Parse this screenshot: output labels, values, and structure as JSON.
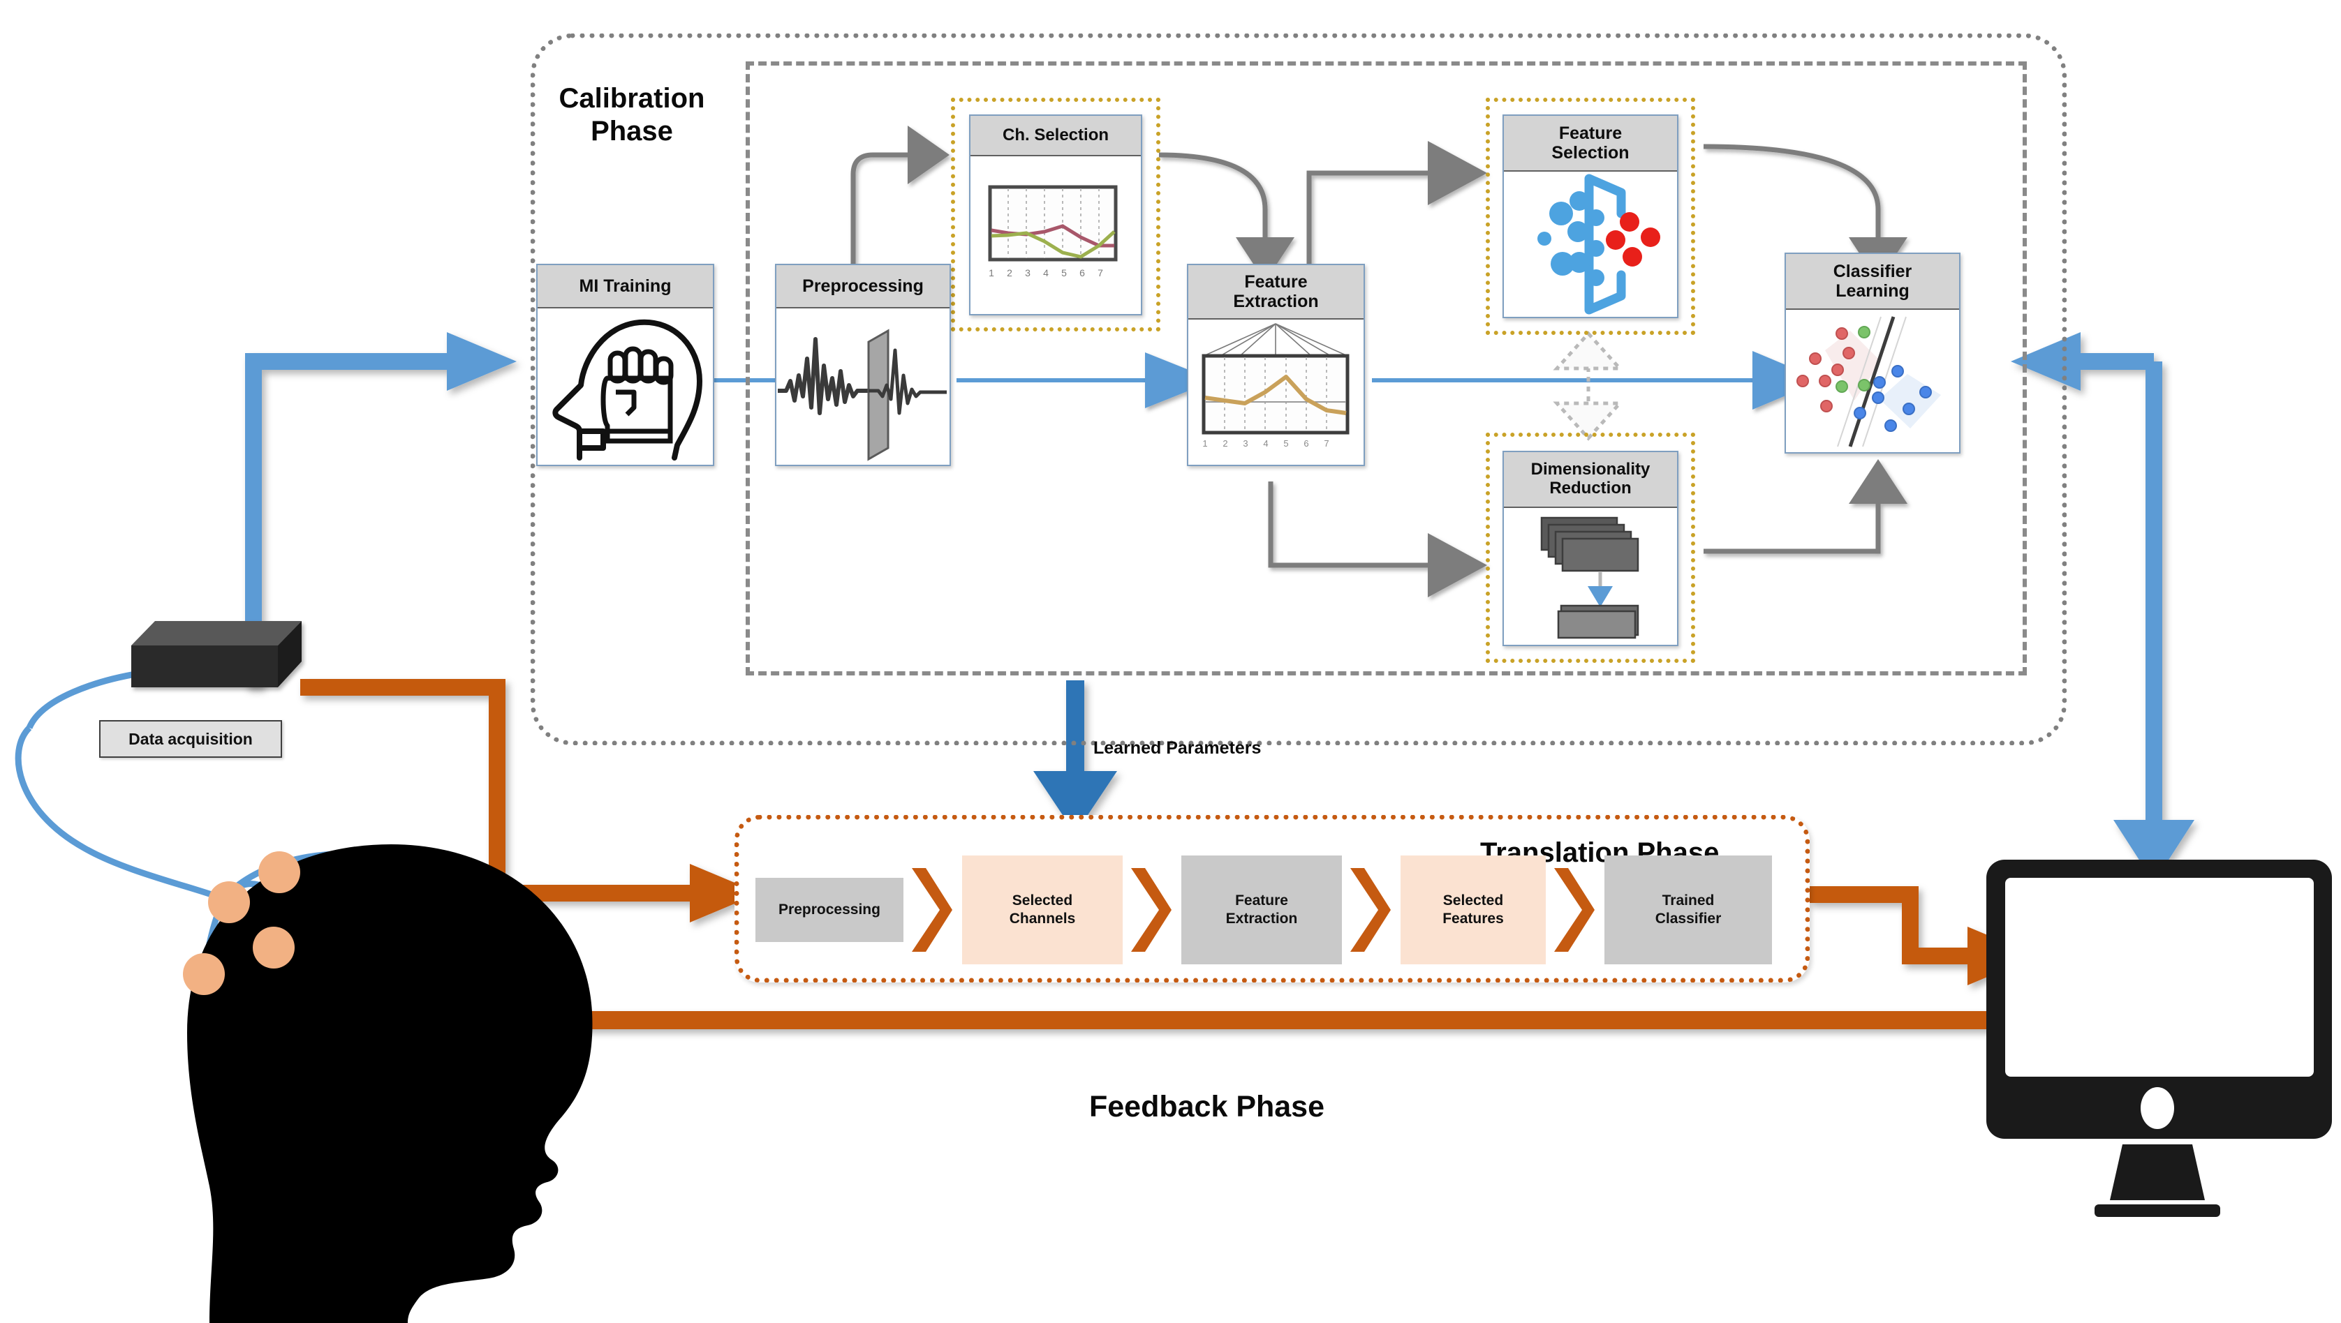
{
  "diagram": {
    "title_calibration": "Calibration\nPhase",
    "calibration_title_line1": "Calibration",
    "calibration_title_line2": "Phase",
    "translation_title": "Translation Phase",
    "feedback_title": "Feedback Phase",
    "learned_parameters_label": "Learned Parameters",
    "data_acquisition_label": "Data acquisition"
  },
  "colors": {
    "blue_arrow": "#5b9bd5",
    "orange_arrow": "#c55a11",
    "gray_arrow": "#808080",
    "gold_dotted": "#c9a227",
    "box_border": "#7f9fc0",
    "header_fill": "#d4d4d4",
    "pipe_gray": "#c9c9c9",
    "pipe_peach": "#fbe2d1",
    "electrode": "#f2b183",
    "head_silhouette": "#000000"
  },
  "calibration": {
    "modules": [
      {
        "id": "mi-training",
        "title": "MI Training",
        "title_lines": [
          "MI Training"
        ],
        "icon": "head-with-fist-icon"
      },
      {
        "id": "preprocessing",
        "title": "Preprocessing",
        "title_lines": [
          "Preprocessing"
        ],
        "icon": "signal-filter-icon"
      },
      {
        "id": "ch-selection",
        "title": "Ch. Selection",
        "title_lines": [
          "Ch. Selection"
        ],
        "icon": "multichannel-line-chart-icon",
        "selected": true
      },
      {
        "id": "feature-extraction",
        "title": "Feature Extraction",
        "title_lines": [
          "Feature",
          "Extraction"
        ],
        "icon": "feature-line-chart-icon"
      },
      {
        "id": "feature-selection",
        "title": "Feature Selection",
        "title_lines": [
          "Feature",
          "Selection"
        ],
        "icon": "funnel-filter-dots-icon",
        "selected": true
      },
      {
        "id": "dimensionality-reduction",
        "title": "Dimensionality Reduction",
        "title_lines": [
          "Dimensionality",
          "Reduction"
        ],
        "icon": "layer-stack-reduce-icon",
        "selected": true
      },
      {
        "id": "classifier-learning",
        "title": "Classifier Learning",
        "title_lines": [
          "Classifier",
          "Learning"
        ],
        "icon": "svm-scatter-icon"
      }
    ]
  },
  "translation": {
    "steps": [
      {
        "label": "Preprocessing",
        "label_lines": [
          "Preprocessing"
        ],
        "style": "gray"
      },
      {
        "label": "Selected Channels",
        "label_lines": [
          "Selected",
          "Channels"
        ],
        "style": "peach"
      },
      {
        "label": "Feature Extraction",
        "label_lines": [
          "Feature",
          "Extraction"
        ],
        "style": "gray"
      },
      {
        "label": "Selected Features",
        "label_lines": [
          "Selected",
          "Features"
        ],
        "style": "peach"
      },
      {
        "label": "Trained Classifier",
        "label_lines": [
          "Trained",
          "Classifier"
        ],
        "style": "gray"
      }
    ]
  },
  "chart_data": [
    {
      "type": "line",
      "id": "ch-selection-chart",
      "title": "Ch. Selection",
      "x": [
        1,
        2,
        3,
        4,
        5,
        6,
        7
      ],
      "xticklabels": [
        "1",
        "2",
        "3",
        "4",
        "5",
        "6",
        "7"
      ],
      "series": [
        {
          "name": "channel-a",
          "color": "#a8576a",
          "values": [
            0.62,
            0.55,
            0.53,
            0.6,
            0.46,
            0.34,
            0.33
          ]
        },
        {
          "name": "channel-b",
          "color": "#9cb04e",
          "values": [
            0.5,
            0.52,
            0.54,
            0.35,
            0.12,
            0.3,
            0.66
          ]
        }
      ],
      "ylim": [
        0,
        1
      ],
      "grid": true,
      "legend": "none"
    },
    {
      "type": "line",
      "id": "feature-extraction-chart",
      "title": "Feature Extraction",
      "x": [
        1,
        2,
        3,
        4,
        5,
        6,
        7
      ],
      "xticklabels": [
        "1",
        "2",
        "3",
        "4",
        "5",
        "6",
        "7"
      ],
      "series": [
        {
          "name": "feature",
          "color": "#c9a15a",
          "values": [
            0.52,
            0.46,
            0.42,
            0.62,
            0.84,
            0.47,
            0.34
          ]
        }
      ],
      "ylim": [
        0,
        1
      ],
      "grid": true,
      "legend": "none"
    },
    {
      "type": "scatter",
      "id": "classifier-learning-chart",
      "title": "Classifier Learning",
      "xlabel": "",
      "ylabel": "",
      "xlim": [
        0,
        1
      ],
      "ylim": [
        0,
        1
      ],
      "grid": false,
      "legend": "none",
      "series": [
        {
          "name": "class-red",
          "color": "#e06666",
          "points": [
            [
              0.3,
              0.84
            ],
            [
              0.34,
              0.7
            ],
            [
              0.14,
              0.54
            ],
            [
              0.07,
              0.4
            ],
            [
              0.2,
              0.4
            ],
            [
              0.25,
              0.62
            ],
            [
              0.2,
              0.21
            ]
          ]
        },
        {
          "name": "class-green",
          "color": "#7bc36a",
          "points": [
            [
              0.44,
              0.85
            ],
            [
              0.29,
              0.38
            ],
            [
              0.5,
              0.39
            ]
          ]
        },
        {
          "name": "class-blue",
          "color": "#4a86e8",
          "points": [
            [
              0.72,
              0.45
            ],
            [
              0.62,
              0.4
            ],
            [
              0.59,
              0.3
            ],
            [
              0.78,
              0.24
            ],
            [
              0.88,
              0.33
            ],
            [
              0.43,
              0.17
            ],
            [
              0.61,
              0.1
            ]
          ]
        }
      ],
      "decision_boundary": {
        "name": "hyperplane",
        "color": "#404040",
        "from": [
          0.3,
          0.04
        ],
        "to": [
          0.58,
          0.9
        ]
      },
      "margins": [
        {
          "from": [
            0.22,
            0.04
          ],
          "to": [
            0.5,
            0.9
          ]
        },
        {
          "from": [
            0.38,
            0.04
          ],
          "to": [
            0.66,
            0.9
          ]
        }
      ]
    },
    {
      "type": "scatter",
      "id": "feature-selection-chart",
      "title": "Feature Selection",
      "grid": false,
      "legend": "none",
      "series": [
        {
          "name": "input-features",
          "color": "#4da3e0",
          "count": 9
        },
        {
          "name": "selected-features",
          "color": "#e8201a",
          "count": 4
        }
      ]
    }
  ]
}
